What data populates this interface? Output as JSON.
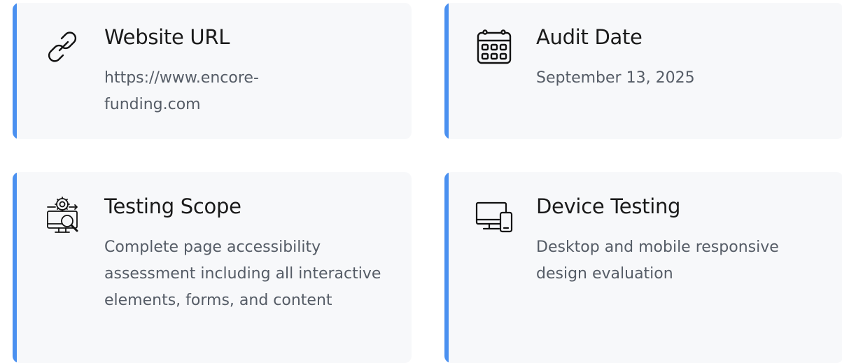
{
  "cards": [
    {
      "title": "Website URL",
      "text": "https://www.encore-funding.com",
      "icon": "link-icon",
      "accent": "#4a90f0"
    },
    {
      "title": "Audit Date",
      "text": "September 13, 2025",
      "icon": "calendar-icon",
      "accent": "#4a90f0"
    },
    {
      "title": "Testing Scope",
      "text": "Complete page accessibility assessment including all interactive elements, forms, and content",
      "icon": "testing-scope-icon",
      "accent": "#4a90f0"
    },
    {
      "title": "Device Testing",
      "text": "Desktop and mobile responsive design evaluation",
      "icon": "devices-icon",
      "accent": "#4a90f0"
    }
  ]
}
